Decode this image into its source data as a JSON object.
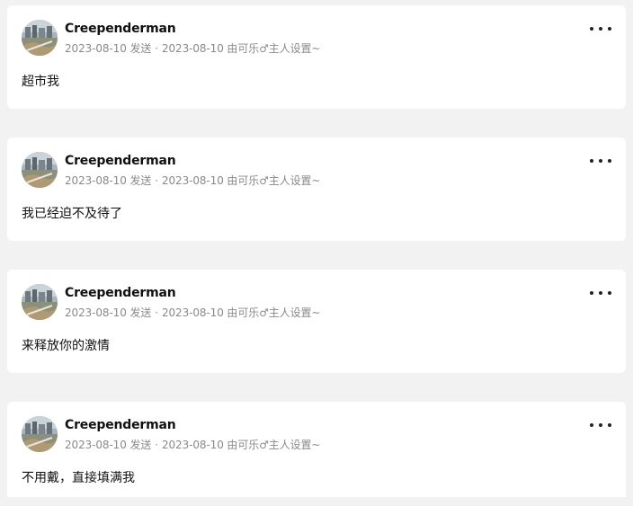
{
  "posts": [
    {
      "author": "Creependerman",
      "sent": "2023-08-10 发送",
      "set_by": "2023-08-10 由可乐♂主人设置~",
      "content": "超市我"
    },
    {
      "author": "Creependerman",
      "sent": "2023-08-10 发送",
      "set_by": "2023-08-10 由可乐♂主人设置~",
      "content": "我已经迫不及待了"
    },
    {
      "author": "Creependerman",
      "sent": "2023-08-10 发送",
      "set_by": "2023-08-10 由可乐♂主人设置~",
      "content": "来释放你的激情"
    },
    {
      "author": "Creependerman",
      "sent": "2023-08-10 发送",
      "set_by": "2023-08-10 由可乐♂主人设置~",
      "content": "不用戴，直接填满我"
    }
  ],
  "icons": {
    "more": "more-horizontal-icon",
    "avatar": "avatar-photo"
  },
  "colors": {
    "background": "#f2f2f2",
    "card": "#ffffff",
    "meta_text": "#8a8a8a"
  }
}
